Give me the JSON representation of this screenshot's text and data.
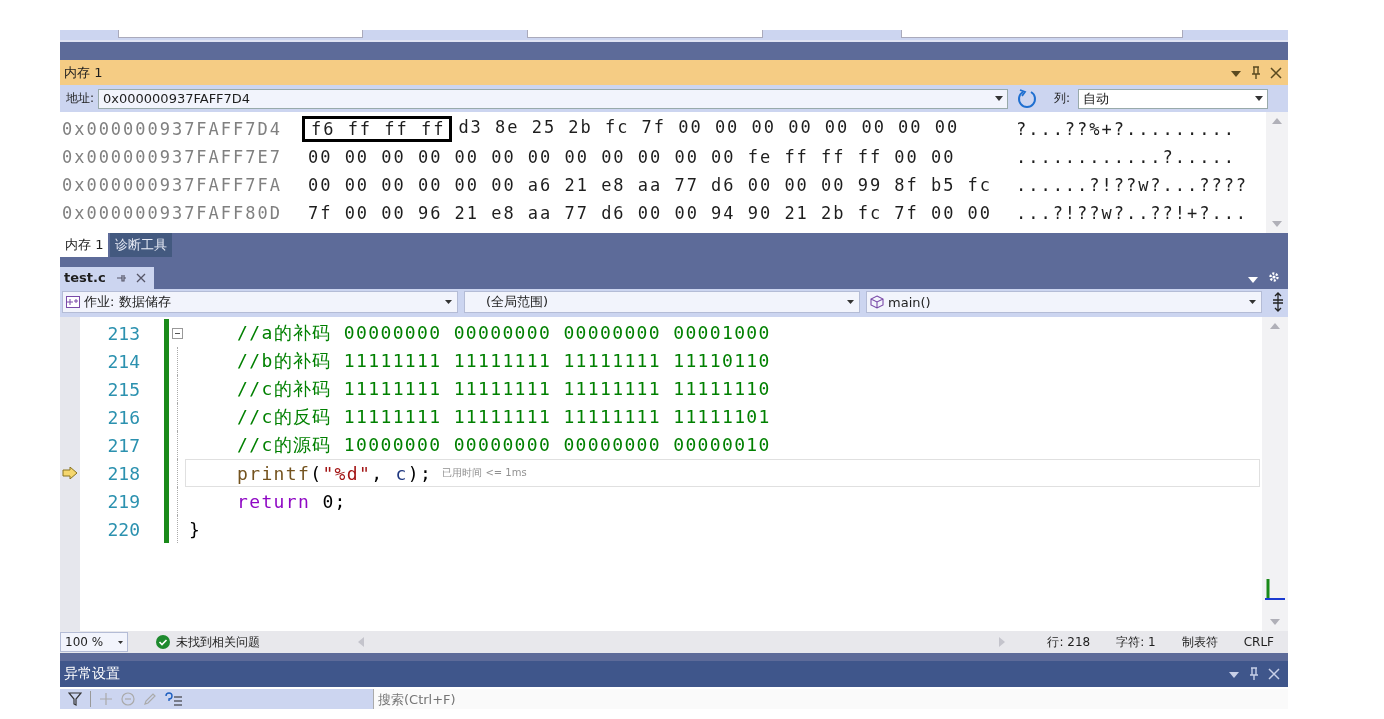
{
  "memory_panel": {
    "title": "内存 1",
    "address_label": "地址:",
    "address": "0x000000937FAFF7D4",
    "columns_label": "列:",
    "columns_value": "自动",
    "rows": [
      {
        "address": "0x000000937FAFF7D4",
        "groups": [
          {
            "text": "f6 ff ff ff",
            "boxed": true
          },
          {
            "text": "d3 8e 25 2b fc 7f 00 00 00 00 00 00 00 00",
            "boxed": false
          }
        ],
        "ascii": "?...??%+?........."
      },
      {
        "address": "0x000000937FAFF7E7",
        "groups": [
          {
            "text": "00 00 00 00 00 00 00 00 00 00 00 00 fe ff ff ff 00 00",
            "boxed": false
          }
        ],
        "ascii": "............?....."
      },
      {
        "address": "0x000000937FAFF7FA",
        "groups": [
          {
            "text": "00 00 00 00 00 00 a6 21 e8 aa 77 d6 00 00 00 99 8f b5 fc",
            "boxed": false
          }
        ],
        "ascii": "......?!??w?...????"
      },
      {
        "address": "0x000000937FAFF80D",
        "groups": [
          {
            "text": "7f 00 00 96 21 e8 aa 77 d6 00 00 94 90 21 2b fc 7f 00 00",
            "boxed": false
          }
        ],
        "ascii": "...?!??w?..??!+?..."
      }
    ],
    "tabs": [
      {
        "label": "内存 1",
        "selected": true
      },
      {
        "label": "诊断工具",
        "selected": false
      }
    ]
  },
  "editor": {
    "tabs": [
      {
        "label": "test.c",
        "selected": true
      }
    ],
    "project": "作业: 数据储存",
    "scope": "(全局范围)",
    "function": "main()",
    "lines": [
      {
        "number": "213",
        "indented": true,
        "fold_start": true,
        "current": false,
        "tokens": [
          {
            "kind": "comment",
            "text": "//a的补码 00000000 00000000 00000000 00001000"
          }
        ]
      },
      {
        "number": "214",
        "indented": true,
        "fold_start": false,
        "current": false,
        "tokens": [
          {
            "kind": "comment",
            "text": "//b的补码 11111111 11111111 11111111 11110110"
          }
        ]
      },
      {
        "number": "215",
        "indented": true,
        "fold_start": false,
        "current": false,
        "tokens": [
          {
            "kind": "comment",
            "text": "//c的补码 11111111 11111111 11111111 11111110"
          }
        ]
      },
      {
        "number": "216",
        "indented": true,
        "fold_start": false,
        "current": false,
        "tokens": [
          {
            "kind": "comment",
            "text": "//c的反码 11111111 11111111 11111111 11111101"
          }
        ]
      },
      {
        "number": "217",
        "indented": true,
        "fold_start": false,
        "current": false,
        "tokens": [
          {
            "kind": "comment",
            "text": "//c的源码 10000000 00000000 00000000 00000010"
          }
        ]
      },
      {
        "number": "218",
        "indented": true,
        "fold_start": false,
        "current": true,
        "annotation": "已用时间 <= 1ms",
        "tokens": [
          {
            "kind": "func",
            "text": "printf"
          },
          {
            "kind": "punct",
            "text": "("
          },
          {
            "kind": "string",
            "text": "\"%d\""
          },
          {
            "kind": "punct",
            "text": ", "
          },
          {
            "kind": "var",
            "text": "c"
          },
          {
            "kind": "punct",
            "text": ");"
          }
        ]
      },
      {
        "number": "219",
        "indented": true,
        "fold_start": false,
        "current": false,
        "tokens": [
          {
            "kind": "keyword",
            "text": "return"
          },
          {
            "kind": "punct",
            "text": " 0;"
          }
        ]
      },
      {
        "number": "220",
        "indented": false,
        "fold_start": false,
        "current": false,
        "tokens": [
          {
            "kind": "punct",
            "text": "}"
          }
        ]
      }
    ]
  },
  "status_bar": {
    "zoom": "100 %",
    "issues": "未找到相关问题",
    "line": "行: 218",
    "char": "字符: 1",
    "indent": "制表符",
    "eol": "CRLF"
  },
  "exceptions_panel": {
    "title": "异常设置",
    "search": {
      "placeholder": "搜索(Ctrl+F)"
    }
  }
}
